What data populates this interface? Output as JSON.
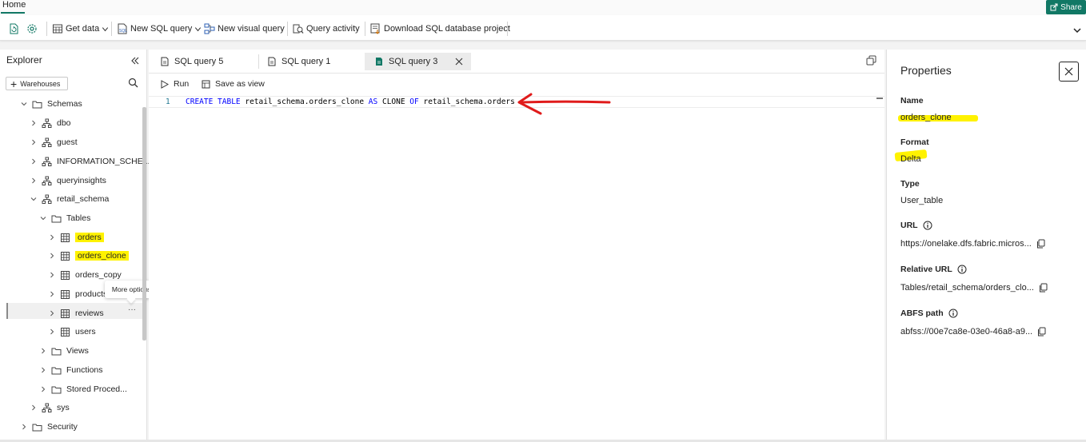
{
  "header": {
    "home_tab": "Home",
    "share_label": "Share",
    "accent_color": "#117865"
  },
  "toolbar": {
    "get_data": "Get data",
    "new_sql_query": "New SQL query",
    "new_visual_query": "New visual query",
    "query_activity": "Query activity",
    "download_project": "Download SQL database project"
  },
  "explorer": {
    "title": "Explorer",
    "warehouses_button": "Warehouses",
    "tree": [
      {
        "label": "Schemas",
        "icon": "folder-icon",
        "expanded": true
      },
      {
        "label": "dbo",
        "icon": "schema-icon"
      },
      {
        "label": "guest",
        "icon": "schema-icon"
      },
      {
        "label": "INFORMATION_SCHE...",
        "icon": "schema-icon"
      },
      {
        "label": "queryinsights",
        "icon": "schema-icon"
      },
      {
        "label": "retail_schema",
        "icon": "schema-icon",
        "expanded": true
      },
      {
        "label": "Tables",
        "icon": "folder-icon",
        "expanded": true
      },
      {
        "label": "orders",
        "icon": "table-icon",
        "highlighted": true
      },
      {
        "label": "orders_clone",
        "icon": "table-icon",
        "highlighted": true
      },
      {
        "label": "orders_copy",
        "icon": "table-icon"
      },
      {
        "label": "products",
        "icon": "table-icon"
      },
      {
        "label": "reviews",
        "icon": "table-icon"
      },
      {
        "label": "users",
        "icon": "table-icon"
      },
      {
        "label": "Views",
        "icon": "folder-icon"
      },
      {
        "label": "Functions",
        "icon": "folder-icon"
      },
      {
        "label": "Stored Proced...",
        "icon": "folder-icon"
      },
      {
        "label": "sys",
        "icon": "schema-icon"
      },
      {
        "label": "Security",
        "icon": "folder-icon"
      }
    ],
    "more_options_tooltip": "More options",
    "more_options_glyph": "···"
  },
  "editor": {
    "tabs": [
      {
        "label": "SQL query 5"
      },
      {
        "label": "SQL query 1"
      },
      {
        "label": "SQL query 3",
        "active": true
      }
    ],
    "run_label": "Run",
    "save_as_view_label": "Save as view",
    "line_number": "1",
    "code": {
      "kw1": "CREATE TABLE",
      "t1": " retail_schema.orders_clone ",
      "kw2": "AS",
      "t2": " CLONE ",
      "kw3": "OF",
      "t3": " retail_schema.orders"
    },
    "annotation_color": "#e01b1b"
  },
  "properties": {
    "title": "Properties",
    "name_label": "Name",
    "name_value": "orders_clone",
    "format_label": "Format",
    "format_value": "Delta",
    "type_label": "Type",
    "type_value": "User_table",
    "url_label": "URL",
    "url_value": "https://onelake.dfs.fabric.micros...",
    "relative_url_label": "Relative URL",
    "relative_url_value": "Tables/retail_schema/orders_clo...",
    "abfs_label": "ABFS path",
    "abfs_value": "abfss://00e7ca8e-03e0-46a8-a9...",
    "highlight_color": "#fff200"
  }
}
